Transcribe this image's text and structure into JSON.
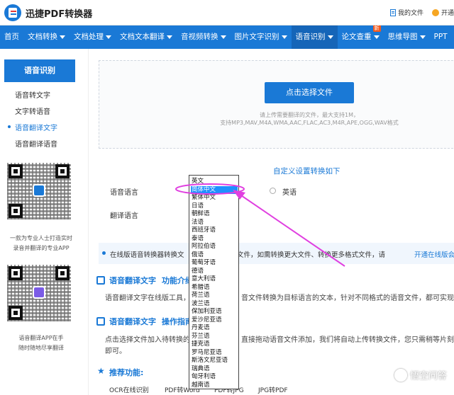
{
  "header": {
    "logo_text": "迅捷PDF转换器",
    "my_files": "我的文件",
    "vip": "开通"
  },
  "nav": [
    {
      "label": "首页",
      "caret": false
    },
    {
      "label": "文档转换",
      "caret": true
    },
    {
      "label": "文档处理",
      "caret": true
    },
    {
      "label": "文档文本翻译",
      "caret": true
    },
    {
      "label": "音视频转换",
      "caret": true
    },
    {
      "label": "图片文字识别",
      "caret": true
    },
    {
      "label": "语音识别",
      "caret": true,
      "active": true
    },
    {
      "label": "论文查重",
      "caret": true,
      "badge": "新"
    },
    {
      "label": "思维导图",
      "caret": true
    },
    {
      "label": "PPT",
      "caret": false
    }
  ],
  "sidebar": {
    "title": "语音识别",
    "items": [
      "语音转文字",
      "文字转语音",
      "语音翻译文字",
      "语音翻译语音"
    ],
    "active_index": 2,
    "qr1_caption": [
      "一款为专业人士打造实时",
      "录音并翻译的专业APP"
    ],
    "qr2_caption": [
      "语音翻译APP在手",
      "随时随地尽享翻译"
    ]
  },
  "upload": {
    "button": "点击选择文件",
    "tip1": "请上传需要翻译的文件，最大支持1M，",
    "tip2": "支持MP3,MAV,M4A,WMA,AAC,FLAC,AC3,M4R,APE,OGG,WAV格式"
  },
  "settings": {
    "title": "自定义设置转换如下",
    "source_label": "语音语言",
    "target_label": "翻译语言",
    "radio_english": "英语",
    "dropdown_options": [
      "英文",
      "简体中文",
      "繁体中文",
      "日语",
      "朝鲜语",
      "法语",
      "西班牙语",
      "泰语",
      "阿拉伯语",
      "俄语",
      "葡萄牙语",
      "德语",
      "意大利语",
      "希腊语",
      "荷兰语",
      "波兰语",
      "保加利亚语",
      "爱沙尼亚语",
      "丹麦语",
      "芬兰语",
      "捷克语",
      "罗马尼亚语",
      "斯洛文尼亚语",
      "瑞典语",
      "匈牙利语",
      "越南语"
    ],
    "selected_index": 1
  },
  "notice": {
    "left": "在线版语音转换器转换文",
    "mid": "文件，如需转换更大文件、转换更多格式文件，请",
    "link": "开通在线版会员。"
  },
  "section1": {
    "title_left": "语音翻译文字",
    "title_right": "功能介绍",
    "text_left": "语音翻译文字在线版工具，",
    "text_right": "音文件转换为目标语言的文本，针对不同格式的语音文件，都可实现一"
  },
  "section2": {
    "title_left": "语音翻译文字",
    "title_right": "操作指南",
    "text1_left": "点击选择文件加入待转换的",
    "text1_right": "直接拖动语音文件添加，我们将自动上传转换文件，您只需稍等片刻",
    "text2": "即可。"
  },
  "section3": {
    "title": "推荐功能:",
    "links": [
      "OCR在线识别",
      "PDF转Word",
      "PDF转JPG",
      "JPG转PDF"
    ]
  },
  "watermark": "悟空问答",
  "colors": {
    "brand": "#1a79d6",
    "nav_active": "#1565b8",
    "badge": "#f55a1e",
    "annotation": "#e040e0"
  }
}
